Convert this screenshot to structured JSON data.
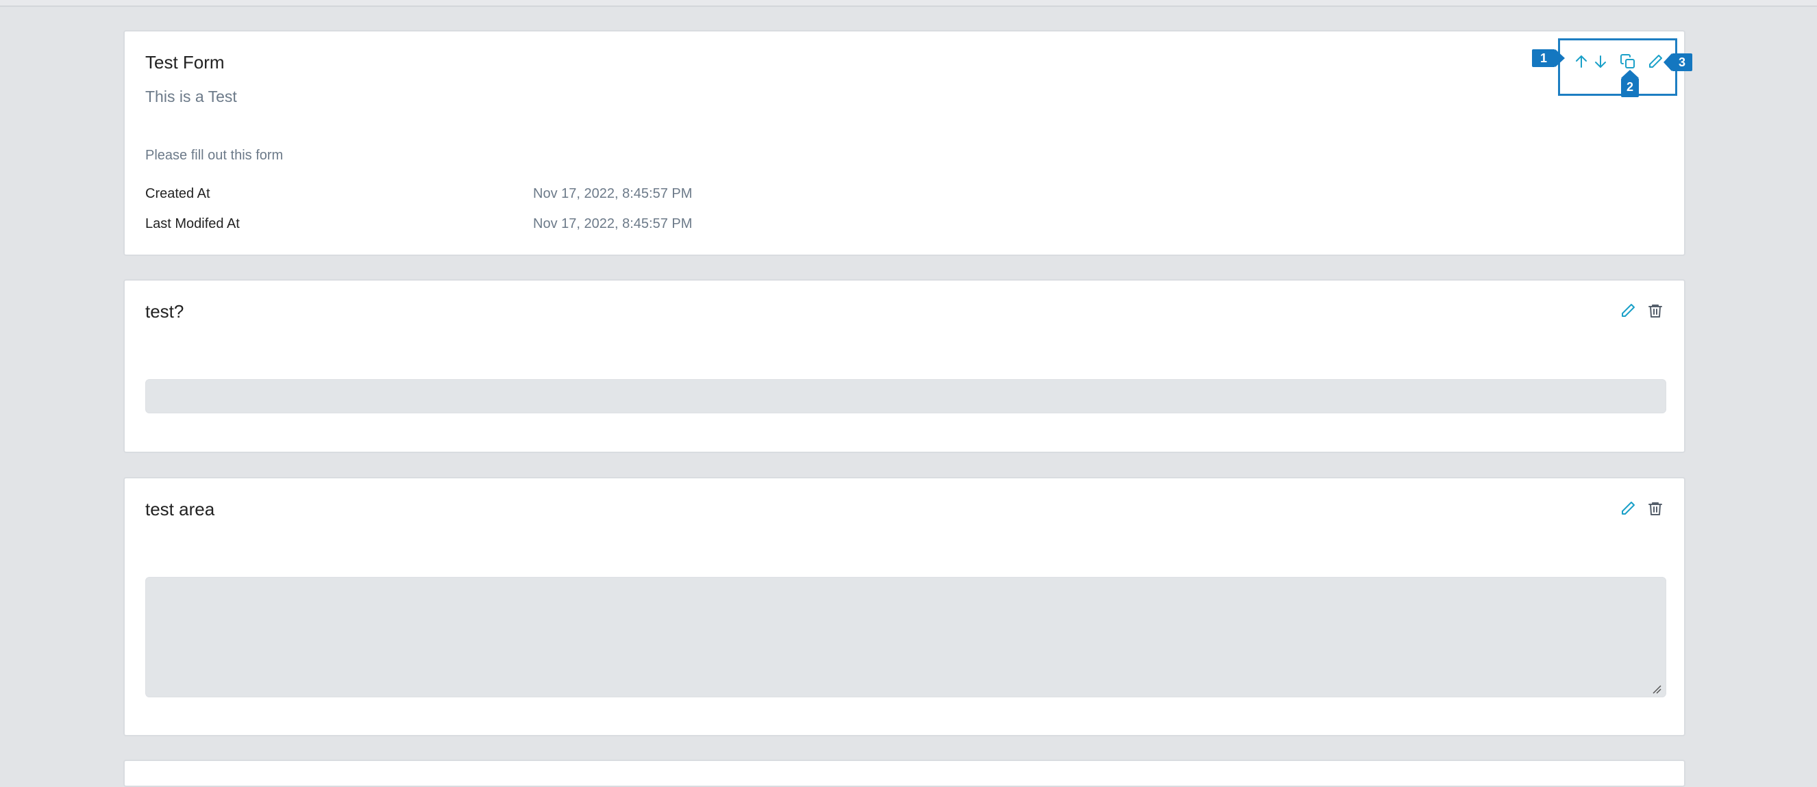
{
  "form": {
    "title": "Test Form",
    "subtitle": "This is a Test",
    "description": "Please fill out this form",
    "created_label": "Created At",
    "created_value": "Nov 17, 2022, 8:45:57 PM",
    "modified_label": "Last Modifed At",
    "modified_value": "Nov 17, 2022, 8:45:57 PM"
  },
  "questions": [
    {
      "title": "test?",
      "type": "text"
    },
    {
      "title": "test area",
      "type": "textarea"
    }
  ],
  "callouts": [
    "1",
    "2",
    "3"
  ],
  "icons": {
    "move_up": "arrow-up-icon",
    "move_down": "arrow-down-icon",
    "duplicate": "copy-icon",
    "edit": "pencil-icon",
    "delete": "trash-icon"
  },
  "colors": {
    "accent": "#1aa0c8",
    "callout": "#1477c0",
    "delete_icon": "#555f6b",
    "background": "#e2e4e7"
  }
}
